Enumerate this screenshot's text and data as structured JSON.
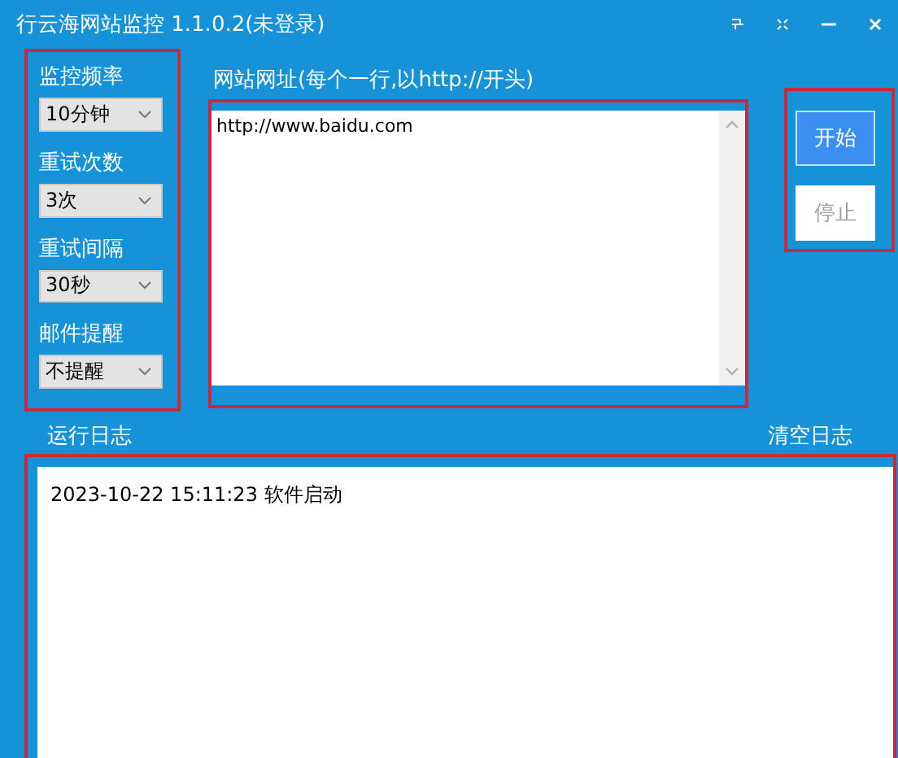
{
  "window": {
    "title": "行云海网站监控 1.1.0.2(未登录)"
  },
  "settings": [
    {
      "label": "监控频率",
      "value": "10分钟"
    },
    {
      "label": "重试次数",
      "value": "3次"
    },
    {
      "label": "重试间隔",
      "value": "30秒"
    },
    {
      "label": "邮件提醒",
      "value": "不提醒"
    }
  ],
  "urls": {
    "label": "网站网址(每个一行,以http://开头)",
    "value": "http://www.baidu.com"
  },
  "buttons": [
    {
      "label": "开始",
      "disabled": false
    },
    {
      "label": "停止",
      "disabled": true
    }
  ],
  "log": {
    "label": "运行日志",
    "clear_label": "清空日志",
    "lines": [
      "2023-10-22 15:11:23 软件启动"
    ]
  }
}
